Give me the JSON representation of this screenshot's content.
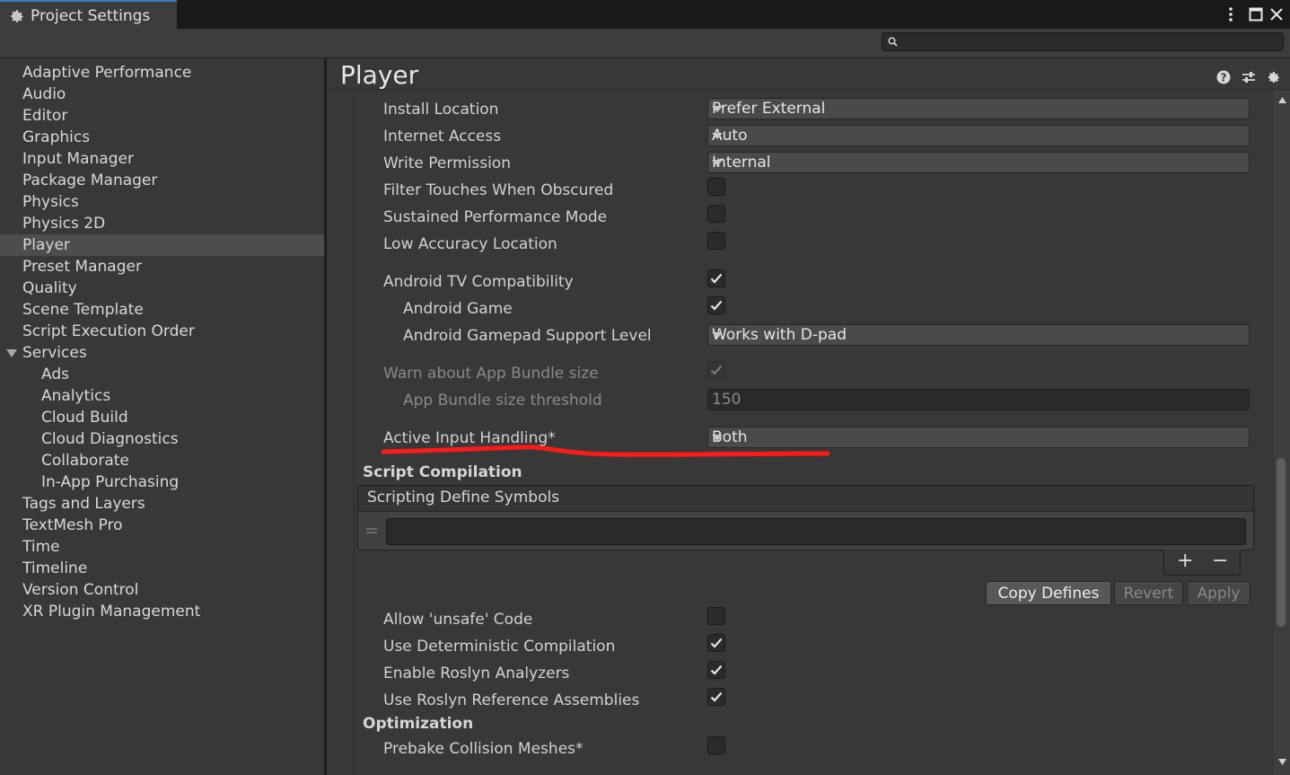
{
  "window": {
    "tab_title": "Project Settings",
    "search_placeholder": ""
  },
  "sidebar": {
    "items": [
      {
        "label": "Adaptive Performance"
      },
      {
        "label": "Audio"
      },
      {
        "label": "Editor"
      },
      {
        "label": "Graphics"
      },
      {
        "label": "Input Manager"
      },
      {
        "label": "Package Manager"
      },
      {
        "label": "Physics"
      },
      {
        "label": "Physics 2D"
      },
      {
        "label": "Player"
      },
      {
        "label": "Preset Manager"
      },
      {
        "label": "Quality"
      },
      {
        "label": "Scene Template"
      },
      {
        "label": "Script Execution Order"
      },
      {
        "label": "Services"
      },
      {
        "label": "Ads"
      },
      {
        "label": "Analytics"
      },
      {
        "label": "Cloud Build"
      },
      {
        "label": "Cloud Diagnostics"
      },
      {
        "label": "Collaborate"
      },
      {
        "label": "In-App Purchasing"
      },
      {
        "label": "Tags and Layers"
      },
      {
        "label": "TextMesh Pro"
      },
      {
        "label": "Time"
      },
      {
        "label": "Timeline"
      },
      {
        "label": "Version Control"
      },
      {
        "label": "XR Plugin Management"
      }
    ],
    "selected": "Player"
  },
  "panel": {
    "title": "Player",
    "icons": [
      "help-icon",
      "preset-icon",
      "gear-icon"
    ]
  },
  "settings": {
    "install_location": {
      "label": "Install Location",
      "value": "Prefer External"
    },
    "internet_access": {
      "label": "Internet Access",
      "value": "Auto"
    },
    "write_permission": {
      "label": "Write Permission",
      "value": "Internal"
    },
    "filter_touches": {
      "label": "Filter Touches When Obscured",
      "checked": false
    },
    "sustained_perf": {
      "label": "Sustained Performance Mode",
      "checked": false
    },
    "low_accuracy": {
      "label": "Low Accuracy Location",
      "checked": false
    },
    "android_tv": {
      "label": "Android TV Compatibility",
      "checked": true
    },
    "android_game": {
      "label": "Android Game",
      "checked": true
    },
    "gamepad_level": {
      "label": "Android Gamepad Support Level",
      "value": "Works with D-pad"
    },
    "warn_bundle": {
      "label": "Warn about App Bundle size",
      "checked": true
    },
    "bundle_threshold": {
      "label": "App Bundle size threshold",
      "value": "150"
    },
    "active_input": {
      "label": "Active Input Handling*",
      "value": "Both"
    }
  },
  "script_compilation": {
    "header": "Script Compilation",
    "list_header": "Scripting Define Symbols",
    "symbol_value": "",
    "add_label": "+",
    "remove_label": "−",
    "copy_defines": "Copy Defines",
    "revert": "Revert",
    "apply": "Apply",
    "allow_unsafe": {
      "label": "Allow 'unsafe' Code",
      "checked": false
    },
    "deterministic": {
      "label": "Use Deterministic Compilation",
      "checked": true
    },
    "roslyn_analyzers": {
      "label": "Enable Roslyn Analyzers",
      "checked": true
    },
    "roslyn_refs": {
      "label": "Use Roslyn Reference Assemblies",
      "checked": true
    }
  },
  "optimization": {
    "header": "Optimization",
    "prebake": {
      "label": "Prebake Collision Meshes*",
      "checked": false
    }
  },
  "annotation": {
    "color": "#ff1a1a"
  }
}
